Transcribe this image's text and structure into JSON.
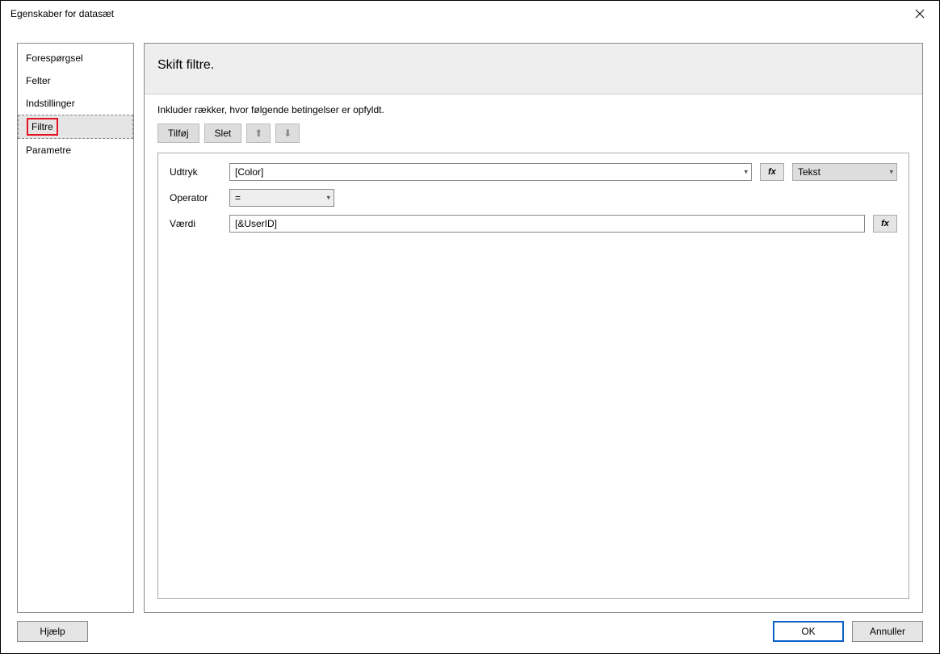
{
  "window": {
    "title": "Egenskaber for datasæt"
  },
  "sidebar": {
    "items": [
      {
        "label": "Forespørgsel"
      },
      {
        "label": "Felter"
      },
      {
        "label": "Indstillinger"
      },
      {
        "label": "Filtre"
      },
      {
        "label": "Parametre"
      }
    ],
    "selected_index": 3
  },
  "main": {
    "heading": "Skift filtre.",
    "instruction": "Inkluder rækker, hvor følgende betingelser er opfyldt.",
    "toolbar": {
      "add": "Tilføj",
      "delete": "Slet"
    },
    "filter": {
      "expression_label": "Udtryk",
      "expression_value": "[Color]",
      "type_label": "Tekst",
      "operator_label": "Operator",
      "operator_value": "=",
      "value_label": "Værdi",
      "value_value": "[&UserID]",
      "fx_label": "fx"
    }
  },
  "footer": {
    "help": "Hjælp",
    "ok": "OK",
    "cancel": "Annuller"
  }
}
